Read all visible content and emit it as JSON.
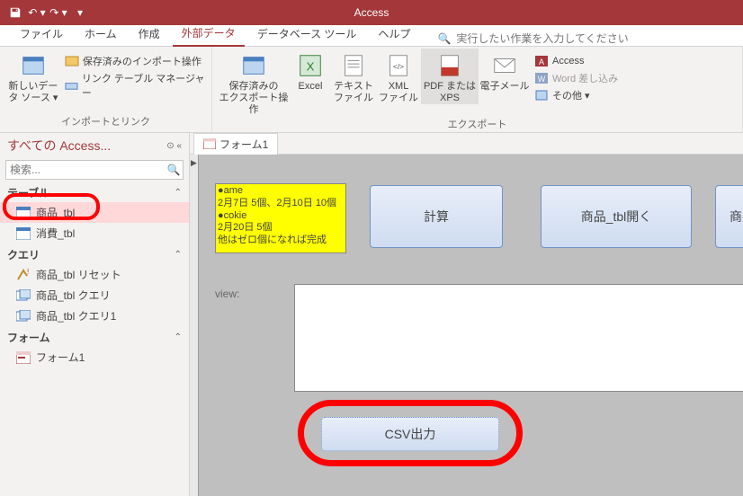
{
  "titlebar": {
    "app_title": "Access"
  },
  "ribbon_tabs": {
    "file": "ファイル",
    "home": "ホーム",
    "create": "作成",
    "external": "外部データ",
    "dbtools": "データベース ツール",
    "help": "ヘルプ",
    "search_hint": "実行したい作業を入力してください"
  },
  "ribbon": {
    "group1": {
      "new_src": "新しいデー\nタ ソース ▾",
      "saved_imports": "保存済みのインポート操作",
      "linked_mgr": "リンク テーブル マネージャー",
      "label": "インポートとリンク"
    },
    "group2": {
      "saved_exports": "保存済みの\nエクスポート操作",
      "excel": "Excel",
      "text": "テキスト\nファイル",
      "xml": "XML\nファイル",
      "pdf": "PDF または\nXPS",
      "email": "電子メール",
      "access": "Access",
      "word": "Word 差し込み",
      "other": "その他 ▾",
      "label": "エクスポート"
    }
  },
  "nav": {
    "title": "すべての Access...",
    "search_placeholder": "検索...",
    "sec_tables": "テーブル",
    "tbl1": "商品_tbl",
    "tbl2": "消費_tbl",
    "sec_queries": "クエリ",
    "q1": "商品_tbl リセット",
    "q2": "商品_tbl クエリ",
    "q3": "商品_tbl クエリ1",
    "sec_forms": "フォーム",
    "f1": "フォーム1"
  },
  "doc": {
    "tab": "フォーム1",
    "note": "●ame\n2月7日 5個、2月10日 10個\n●cokie\n2月20日 5個\n他はゼロ個になれば完成",
    "btn_calc": "計算",
    "btn_open": "商品_tbl開く",
    "btn_prod": "商品",
    "lbl_view": "view:",
    "btn_csv": "CSV出力"
  }
}
